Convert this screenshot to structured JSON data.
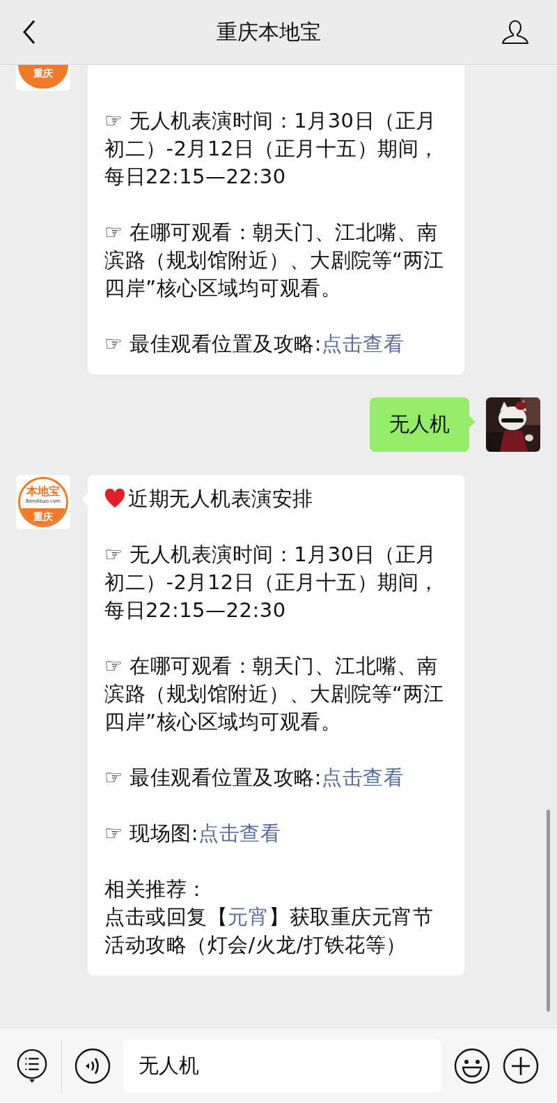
{
  "header": {
    "title": "重庆本地宝"
  },
  "messages": [
    {
      "kind": "incoming",
      "avatar": {
        "kind": "logo",
        "city": "重庆"
      },
      "paragraphs": [
        [
          {
            "text": "☞ 无人机表演时间：1月30日（正月初二）-2月12日（正月十五）期间，每日22:15—22:30"
          }
        ],
        [
          {
            "text": "☞ 在哪可观看：朝天门、江北嘴、南滨路（规划馆附近）、大剧院等“两江四岸”核心区域均可观看。"
          }
        ],
        [
          {
            "text": "☞ 最佳观看位置及攻略:"
          },
          {
            "link": "点击查看"
          }
        ]
      ]
    },
    {
      "kind": "outgoing",
      "text": "无人机"
    },
    {
      "kind": "incoming",
      "avatar": {
        "kind": "logo",
        "brand": "本地宝",
        "site": "Bendibao.com",
        "city": "重庆"
      },
      "title": "近期无人机表演安排",
      "paragraphs": [
        [
          {
            "text": "☞ 无人机表演时间：1月30日（正月初二）-2月12日（正月十五）期间，每日22:15—22:30"
          }
        ],
        [
          {
            "text": "☞ 在哪可观看：朝天门、江北嘴、南滨路（规划馆附近）、大剧院等“两江四岸”核心区域均可观看。"
          }
        ],
        [
          {
            "text": "☞ 最佳观看位置及攻略:"
          },
          {
            "link": "点击查看"
          }
        ],
        [
          {
            "text": "☞ 现场图:"
          },
          {
            "link": "点击查看"
          }
        ]
      ],
      "related": {
        "heading": "相关推荐：",
        "parts": [
          {
            "text": "点击或回复【"
          },
          {
            "link": "元宵"
          },
          {
            "text": "】获取重庆元宵节活动攻略（灯会/火龙/打铁花等）"
          }
        ]
      }
    }
  ],
  "composer": {
    "value": "无人机"
  }
}
